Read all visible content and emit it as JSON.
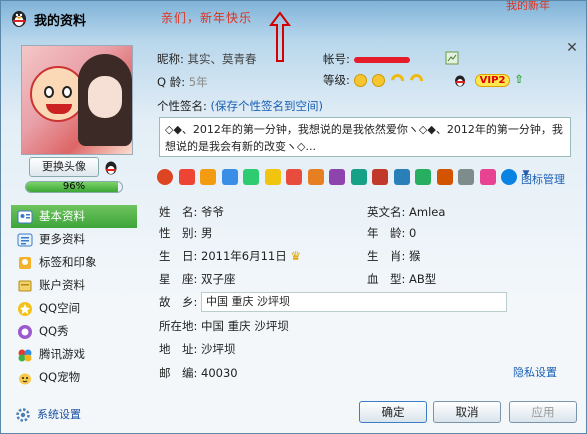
{
  "window": {
    "title": "我的资料",
    "banner": "亲们，新年快乐",
    "banner_top": "我的新年",
    "close": "✕"
  },
  "left": {
    "change_avatar": "更换头像",
    "progress_percent": 96,
    "progress_label": "96%",
    "menu": [
      {
        "label": "基本资料",
        "icon": "profile-card-icon",
        "active": true
      },
      {
        "label": "更多资料",
        "icon": "more-info-icon",
        "active": false
      },
      {
        "label": "标签和印象",
        "icon": "tag-icon",
        "active": false
      },
      {
        "label": "账户资料",
        "icon": "account-icon",
        "active": false
      },
      {
        "label": "QQ空间",
        "icon": "qzone-icon",
        "active": false
      },
      {
        "label": "QQ秀",
        "icon": "qqshow-icon",
        "active": false
      },
      {
        "label": "腾讯游戏",
        "icon": "game-icon",
        "active": false
      },
      {
        "label": "QQ宠物",
        "icon": "pet-icon",
        "active": false
      }
    ],
    "settings": "系统设置"
  },
  "header": {
    "nickname_label": "昵称:",
    "nickname": "其实、莫青春",
    "account_label": "帐号:",
    "qage_label": "Q 龄:",
    "qage": "5年",
    "level_label": "等级:",
    "vip": "VIP2",
    "vip_up": "⇧",
    "signature_label": "个性签名:",
    "save_signature": "(保存个性签名到空间)",
    "signature": "◇◆、2012年的第一分钟，我想说的是我依然爱你ヽ◇◆、2012年的第一分钟，我想说的是我会有新的改变ヽ◇..."
  },
  "icons_manager": "图标管理",
  "fields": {
    "name_label": "姓　名:",
    "name": "爷爷",
    "english_label": "英文名:",
    "english": "Amlea",
    "gender_label": "性　别:",
    "gender": "男",
    "age_label": "年　龄:",
    "age": "0",
    "birthday_label": "生　日:",
    "birthday": "2011年6月11日",
    "zodiac_label": "生　肖:",
    "zodiac": "猴",
    "constellation_label": "星　座:",
    "constellation": "双子座",
    "blood_label": "血　型:",
    "blood": "AB型",
    "hometown_label": "故　乡:",
    "hometown": "中国  重庆  沙坪坝",
    "location_label": "所在地:",
    "location": "中国  重庆  沙坪坝",
    "address_label": "地　址:",
    "address": "沙坪坝",
    "zip_label": "邮　编:",
    "zip": "40030"
  },
  "privacy": "隐私设置",
  "buttons": {
    "ok": "确定",
    "cancel": "取消",
    "apply": "应用"
  },
  "colors": {
    "accent_green": "#3da53a",
    "link_blue": "#1a5fb4",
    "banner_red": "#e0301e"
  }
}
